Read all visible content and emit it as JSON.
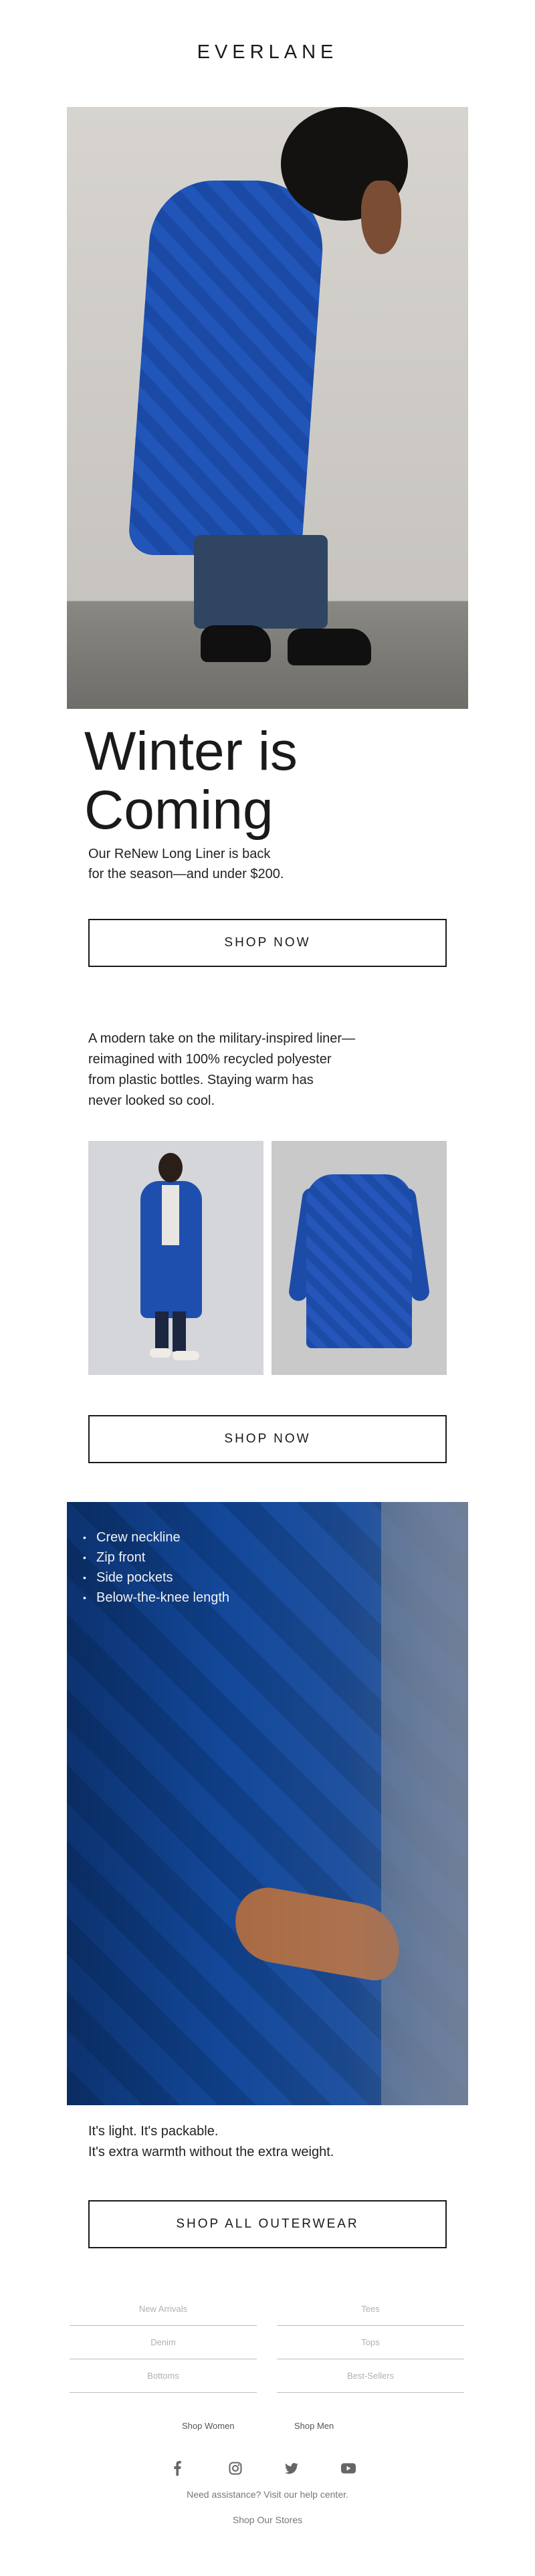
{
  "brand": {
    "logo": "EVERLANE"
  },
  "hero": {
    "headline_line1": "Winter is",
    "headline_line2": "Coming",
    "subcopy_line1": "Our ReNew Long Liner is back",
    "subcopy_line2": "for the season—and under $200."
  },
  "cta": {
    "shop_now_1": "SHOP NOW",
    "shop_now_2": "SHOP NOW",
    "shop_all": "SHOP ALL OUTERWEAR"
  },
  "description": {
    "line1": "A modern take on the military-inspired liner—",
    "line2": "reimagined with 100% recycled polyester",
    "line3": "from plastic bottles. Staying warm has",
    "line4": "never looked so cool."
  },
  "features": [
    "Crew neckline",
    "Zip front",
    "Side pockets",
    "Below-the-knee length"
  ],
  "closing": {
    "line1": "It's light. It's packable.",
    "line2": "It's extra warmth without the extra weight."
  },
  "footer_nav": {
    "left": [
      "New Arrivals",
      "Denim",
      "Bottoms"
    ],
    "right": [
      "Tees",
      "Tops",
      "Best-Sellers"
    ]
  },
  "footer_links": {
    "shop_women": "Shop Women",
    "shop_men": "Shop Men",
    "assistance": "Need assistance? Visit our help center.",
    "stores": "Shop Our Stores"
  },
  "social_icons": [
    "facebook-icon",
    "instagram-icon",
    "twitter-icon",
    "youtube-icon"
  ],
  "colors": {
    "text": "#1a1a1a",
    "accent_blue": "#1f52b3",
    "muted": "#b0b0b0"
  }
}
